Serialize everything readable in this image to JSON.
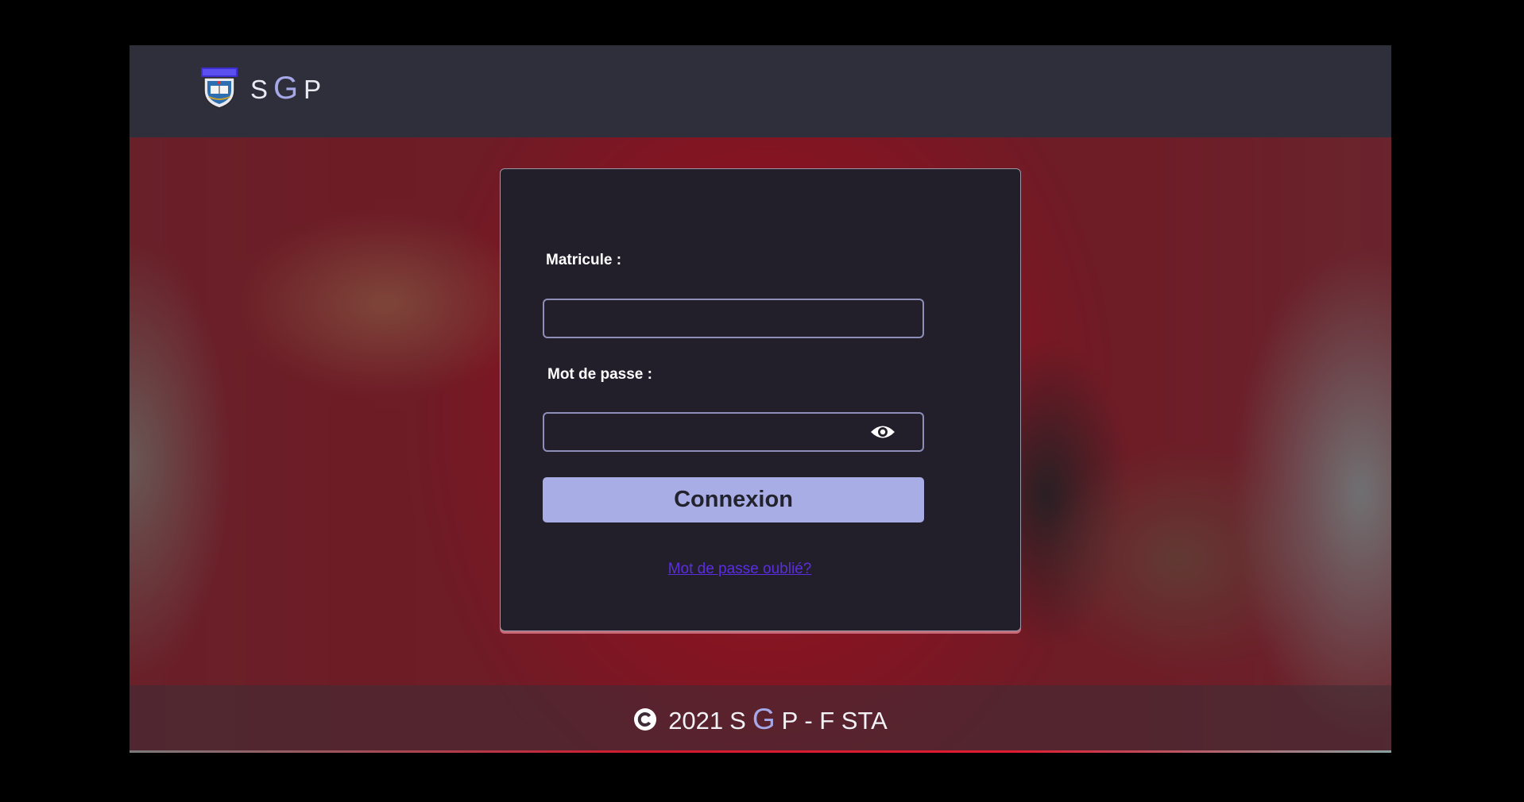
{
  "header": {
    "logo_icon": "university-crest-icon",
    "brand": {
      "s": "S",
      "g": "G",
      "p": "P"
    },
    "colors": {
      "bar": "#2f2f3c",
      "accent": "#a6a8e8"
    }
  },
  "login": {
    "matricule_label": "Matricule :",
    "matricule_value": "",
    "password_label": "Mot de passe :",
    "password_value": "",
    "toggle_visibility_icon": "eye-icon",
    "submit_label": "Connexion",
    "forgot_label": "Mot de passe oublié?",
    "colors": {
      "card": "#221f2b",
      "button": "#a9ade6",
      "link": "#5a2ee0"
    }
  },
  "footer": {
    "copyright_icon": "copyright-icon",
    "year": "2021",
    "s": "S",
    "g": "G",
    "p": "P",
    "suffix": "- F STA"
  }
}
